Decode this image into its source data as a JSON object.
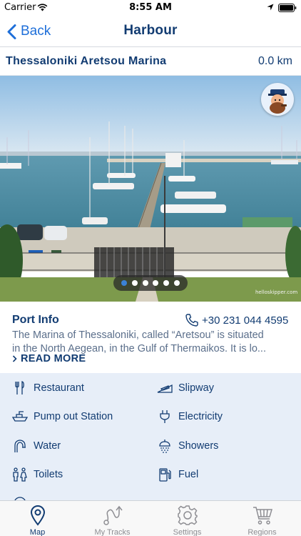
{
  "status_bar": {
    "carrier": "Carrier",
    "time": "8:55 AM"
  },
  "nav": {
    "back_label": "Back",
    "title": "Harbour"
  },
  "marina": {
    "name": "Thessaloniki Aretsou Marina",
    "distance": "0.0 km"
  },
  "photo": {
    "carousel_pages": 6,
    "active_page": 1,
    "watermark": "helloskipper.com"
  },
  "port_info": {
    "title": "Port Info",
    "phone": "+30 231 044 4595",
    "description_lines": [
      "The Marina of Thessaloniki, called “Aretsou” is situated",
      "in the North Aegean, in the Gulf of Thermaikos. It is lo..."
    ],
    "read_more": "READ MORE"
  },
  "facilities": [
    {
      "label": "Restaurant",
      "icon": "cutlery-icon"
    },
    {
      "label": "Slipway",
      "icon": "slipway-icon"
    },
    {
      "label": "Pump out Station",
      "icon": "pump-out-icon"
    },
    {
      "label": "Electricity",
      "icon": "plug-icon"
    },
    {
      "label": "Water",
      "icon": "water-tap-icon"
    },
    {
      "label": "Showers",
      "icon": "shower-icon"
    },
    {
      "label": "Toilets",
      "icon": "toilets-icon"
    },
    {
      "label": "Fuel",
      "icon": "fuel-pump-icon"
    }
  ],
  "tabs": [
    {
      "label": "Map",
      "icon": "map-pin-icon",
      "active": true
    },
    {
      "label": "My Tracks",
      "icon": "tracks-icon",
      "active": false
    },
    {
      "label": "Settings",
      "icon": "gear-icon",
      "active": false
    },
    {
      "label": "Regions",
      "icon": "cart-icon",
      "active": false
    }
  ],
  "colors": {
    "accent": "#1e6fd9",
    "navy": "#123c72",
    "facilities_bg": "#e7eef8",
    "active_dot": "#3b82d6"
  }
}
